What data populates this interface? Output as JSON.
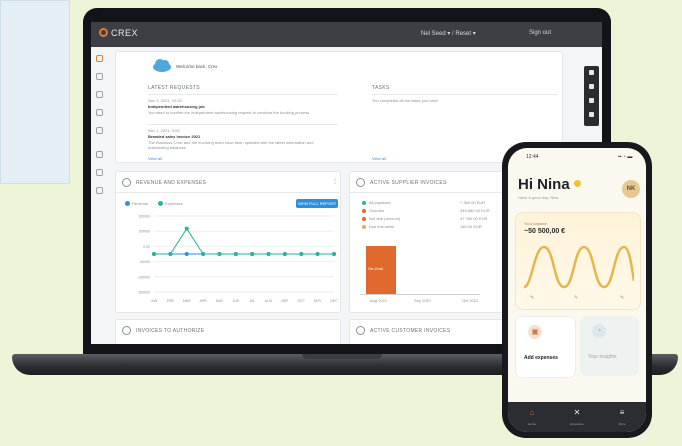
{
  "app": {
    "brand": "CREX",
    "account": "Nel Seed ▾ / Reset ▾",
    "signout": "Sign out"
  },
  "colors": {
    "accent": "#2f8fd8",
    "teal": "#2bb39e",
    "orange": "#e06a2e",
    "topbar": "#3e3f44",
    "phone_card": "#fff3d9"
  },
  "dashboard": {
    "welcome": "Welcome back, Crex",
    "updates_title": "LATEST REQUESTS",
    "update_1_date": "Nov 3, 2021, 10:42",
    "update_1_title": "Independent warehousing job",
    "update_1_text": "You need to confirm the independent warehousing request to continue the booking process",
    "update_2_date": "Nov 1, 2021, 9:05",
    "update_2_title": "Branded sales invoice 2021",
    "update_2_text": "The Business Crew and the invoicing team have been updated with the latest information and outstanding balances",
    "view_all": "View all",
    "tasks_title": "TASKS",
    "tasks_text": "You completed all the tasks you have",
    "tasks_view": "View all",
    "revenue_title": "REVENUE AND EXPENSES",
    "legend_revenue": "Revenue",
    "legend_expenses": "Expenses",
    "view_report": "VIEW FULL REPORT",
    "supplier_title": "ACTIVE SUPPLIER INVOICES",
    "invoices_title": "INVOICES TO AUTHORIZE",
    "supplier_title_2": "ACTIVE CUSTOMER INVOICES",
    "inv_legend": [
      {
        "label": "All payables",
        "value": "7 380.00 EUR"
      },
      {
        "label": "Overdue",
        "value": "345 880.00 EUR"
      },
      {
        "label": "Not due (amount)",
        "value": "47 780.00 EUR"
      },
      {
        "label": "Due this week",
        "value": "180.00 EUR"
      }
    ],
    "inv_bar_label": "On-Hold",
    "inv_axis": [
      "Aug 2021",
      "Sep 2021",
      "Oct 2021"
    ]
  },
  "chart_data": {
    "type": "line",
    "categories": [
      "JAN",
      "FEB",
      "MAR",
      "APR",
      "MAY",
      "JUN",
      "JUL",
      "AUG",
      "SEP",
      "OCT",
      "NOV",
      "DEC"
    ],
    "y_ticks": [
      "150000",
      "100000",
      "0.00",
      "-50000",
      "-100000",
      "-150000"
    ],
    "ylim": [
      -150000,
      150000
    ],
    "series": [
      {
        "name": "Revenue",
        "color": "#2f8fd8",
        "values": [
          0,
          0,
          0,
          0,
          0,
          0,
          0,
          0,
          0,
          0,
          0,
          0
        ]
      },
      {
        "name": "Expenses",
        "color": "#2bb39e",
        "values": [
          0,
          0,
          100000,
          0,
          0,
          0,
          0,
          0,
          0,
          0,
          0,
          0
        ]
      }
    ]
  },
  "phone": {
    "time": "12:44",
    "status": "▪▪ ◔ ▬",
    "greeting": "Hi Nina",
    "greeting_sub": "Have a good day, Nina",
    "avatar": "NK",
    "balance_label": "Your balance",
    "balance_value": "~50 500,00 €",
    "expenses_label": "Add expenses",
    "insights_label": "Your insights",
    "nav_home": "⌂",
    "nav_home_label": "Home",
    "nav_center": "✕",
    "nav_center_label": "Expenses",
    "nav_menu": "≡",
    "nav_menu_label": "More"
  }
}
